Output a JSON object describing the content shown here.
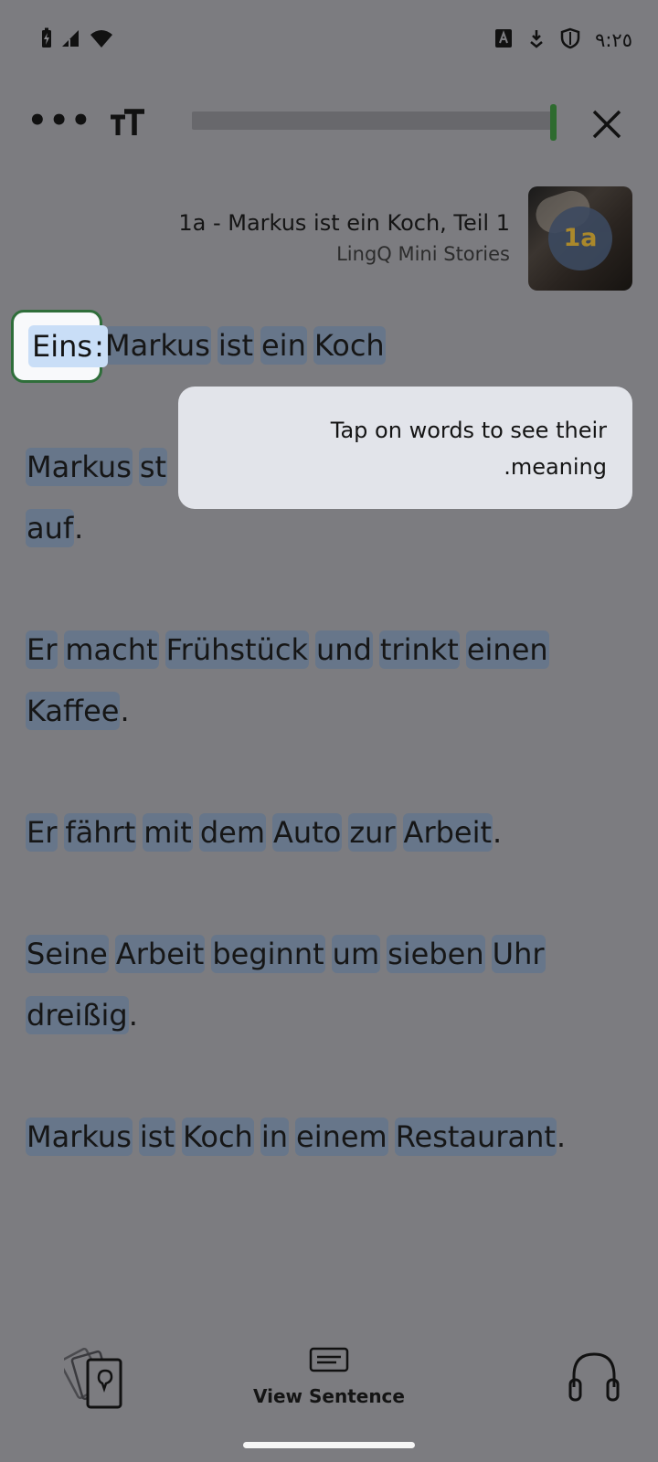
{
  "status_bar": {
    "time": "٩:٢٥",
    "icons": [
      "battery-charging-icon",
      "signal-icon",
      "wifi-icon",
      "keyboard-a-icon",
      "download-shield-icon",
      "shield-icon"
    ]
  },
  "toolbar": {
    "more_label": "•••",
    "icons": [
      "more-icon",
      "text-size-icon",
      "close-icon"
    ],
    "progress_fraction": 1.0
  },
  "lesson": {
    "title": "1a - Markus ist ein Koch, Teil 1",
    "course": "LingQ Mini Stories",
    "thumbnail_badge": "1a"
  },
  "highlighted_word": {
    "text": "Eins",
    "colon": ":"
  },
  "paragraphs": [
    [
      "Eins:",
      "Markus",
      "ist",
      "ein",
      "Koch"
    ],
    [
      "Markus",
      "st",
      "auf."
    ],
    [
      "Er",
      "macht",
      "Frühstück",
      "und",
      "trinkt",
      "einen",
      "Kaffee."
    ],
    [
      "Er",
      "fährt",
      "mit",
      "dem",
      "Auto",
      "zur",
      "Arbeit."
    ],
    [
      "Seine",
      "Arbeit",
      "beginnt",
      "um",
      "sieben",
      "Uhr",
      "dreißig."
    ],
    [
      "Markus",
      "ist",
      "Koch",
      "in",
      "einem",
      "Restaurant."
    ]
  ],
  "reader": {
    "p1_w2": "Markus",
    "p1_w3": "ist",
    "p1_w4": "ein",
    "p1_w5": "Koch",
    "p2_w1": "Markus",
    "p2_w2": "st",
    "p2_w3": "auf",
    "p2_p3": ".",
    "p3_w1": "Er",
    "p3_w2": "macht",
    "p3_w3": "Frühstück",
    "p3_w4": "und",
    "p3_w5": "trinkt",
    "p3_w6": "einen",
    "p3_w7": "Kaffee",
    "p3_p7": ".",
    "p4_w1": "Er",
    "p4_w2": "fährt",
    "p4_w3": "mit",
    "p4_w4": "dem",
    "p4_w5": "Auto",
    "p4_w6": "zur",
    "p4_w7": "Arbeit",
    "p4_p7": ".",
    "p5_w1": "Seine",
    "p5_w2": "Arbeit",
    "p5_w3": "beginnt",
    "p5_w4": "um",
    "p5_w5": "sieben",
    "p5_w6": "Uhr",
    "p5_w7": "dreißig",
    "p5_p7": ".",
    "p6_w1": "Markus",
    "p6_w2": "ist",
    "p6_w3": "Koch",
    "p6_w4": "in",
    "p6_w5": "einem",
    "p6_w6": "Restaurant",
    "p6_p6": "."
  },
  "tooltip": {
    "line1": "Tap on words to see their",
    "line2": ".meaning"
  },
  "bottom_bar": {
    "view_sentence_label": "View Sentence",
    "icons": [
      "flashcards-icon",
      "view-sentence-icon",
      "headphones-icon"
    ]
  },
  "colors": {
    "overlay_background": "#7c7c80",
    "word_highlight": "#67768a",
    "selected_word": "#c9def7",
    "accent_green": "#2e6b2f",
    "tooltip_background": "#e2e4ea"
  }
}
